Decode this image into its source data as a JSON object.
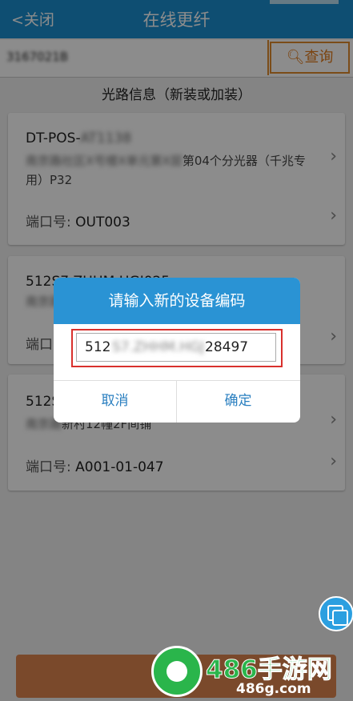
{
  "header": {
    "back_label": "<关闭",
    "title": "在线更纤"
  },
  "search": {
    "query": "3167021B",
    "button_label": "查询"
  },
  "section_title": "光路信息（新装或加装）",
  "cards": [
    {
      "line1": "DT-POS-",
      "line1_blurred": "AT1138",
      "line2_blurred": "南京路社区X号楼X单元第X层",
      "line2": "第04个分光器（千兆专用）P32",
      "port_label": "端口号:",
      "port": "OUT003"
    },
    {
      "line1": "512S7.ZHHM.HGJ025",
      "line2_blurred": "南京路社区",
      "port_label": "端口号:",
      "port": ""
    },
    {
      "line1": "512S",
      "line2_blurred": "南京路",
      "line2": "新村12幢2F间铺",
      "port_label": "端口号:",
      "port": "A001-01-047"
    }
  ],
  "dialog": {
    "title": "请输入新的设备编码",
    "value_prefix": "512",
    "value_blurred": "S7.ZHHM.HGJ",
    "value_suffix": "28497",
    "cancel_label": "取消",
    "ok_label": "确定"
  },
  "watermark": {
    "brand": "486手游网",
    "domain": "486g.com"
  }
}
